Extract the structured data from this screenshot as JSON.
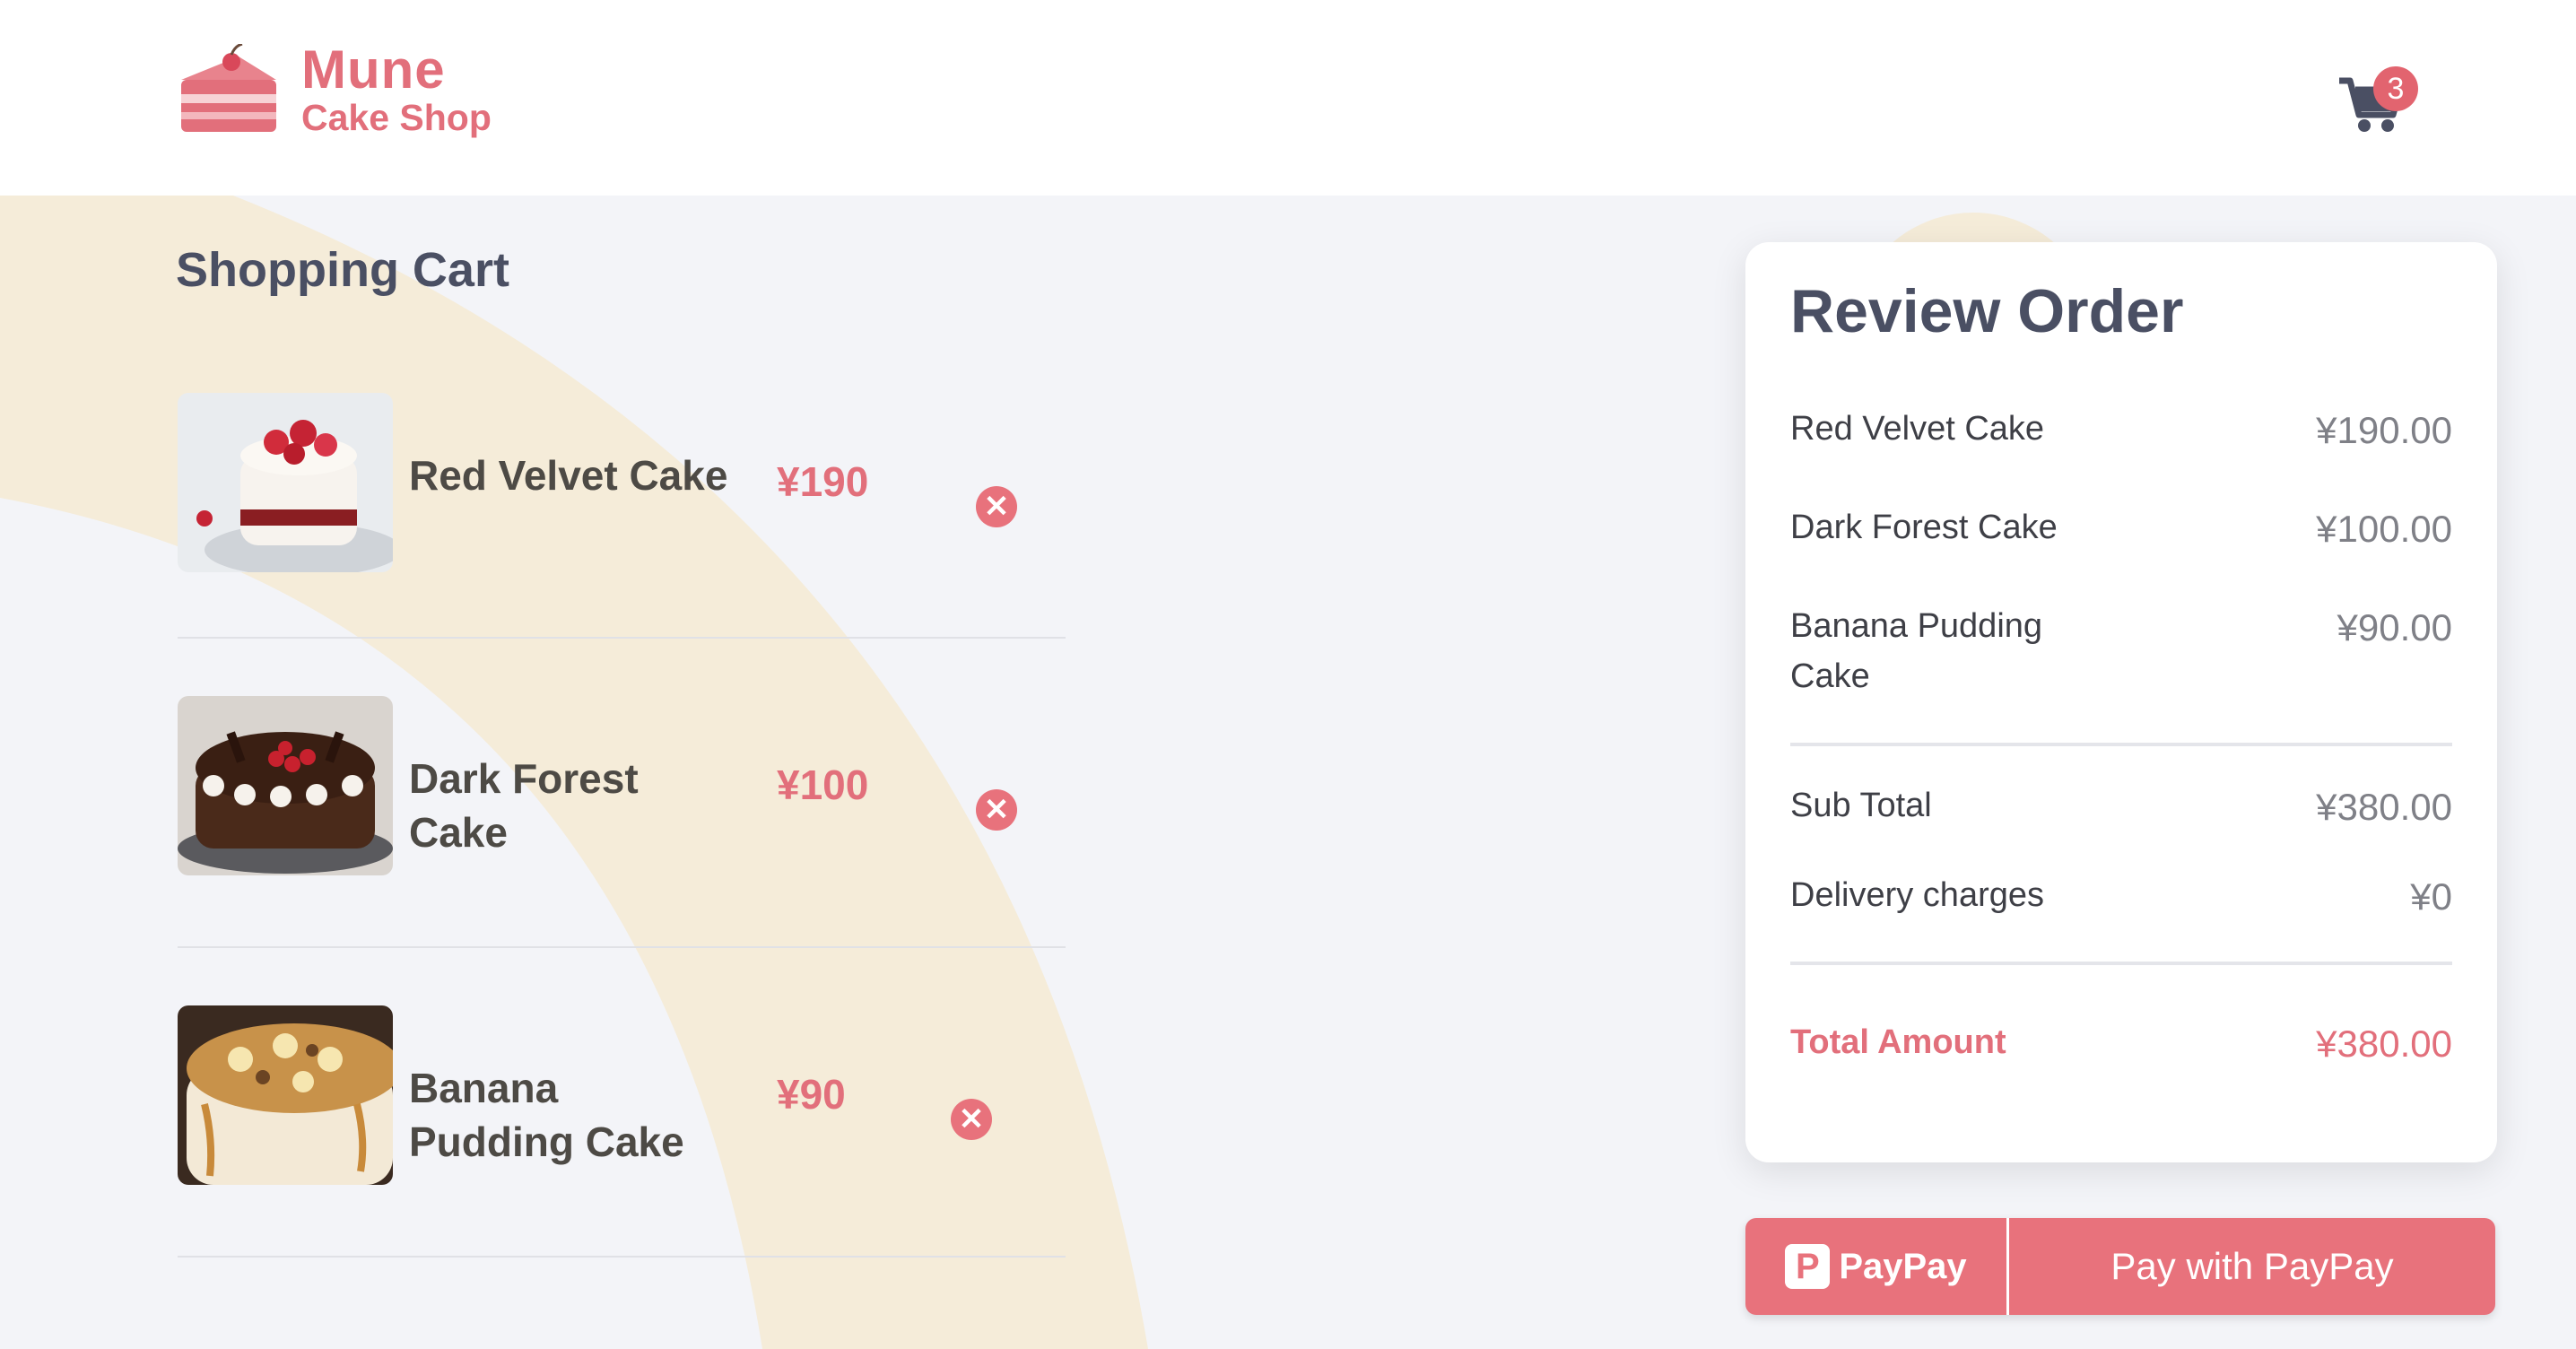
{
  "brand": {
    "name": "Mune",
    "subtitle": "Cake Shop"
  },
  "header": {
    "cart_count": "3"
  },
  "cart": {
    "title": "Shopping Cart",
    "items": [
      {
        "name": "Red Velvet Cake",
        "price": "¥190"
      },
      {
        "name": "Dark Forest Cake",
        "price": "¥100"
      },
      {
        "name": "Banana Pudding Cake",
        "price": "¥90"
      }
    ],
    "remove_glyph": "✕"
  },
  "review": {
    "title": "Review Order",
    "items": [
      {
        "name": "Red Velvet Cake",
        "price": "¥190.00"
      },
      {
        "name": "Dark Forest Cake",
        "price": "¥100.00"
      },
      {
        "name": "Banana Pudding Cake",
        "price": "¥90.00"
      }
    ],
    "subtotal_label": "Sub Total",
    "subtotal_value": "¥380.00",
    "delivery_label": "Delivery charges",
    "delivery_value": "¥0",
    "total_label": "Total Amount",
    "total_value": "¥380.00"
  },
  "payment": {
    "brand": "PayPay",
    "logo_glyph": "P",
    "label": "Pay with PayPay"
  },
  "colors": {
    "accent": "#e26f7b",
    "background": "#f3f4f8",
    "art": "#f5ecd9"
  },
  "icons": {
    "logo": "cake-slice-icon",
    "cart": "shopping-cart-icon",
    "remove": "close-circle-icon",
    "paypay": "paypay-logo-icon"
  }
}
